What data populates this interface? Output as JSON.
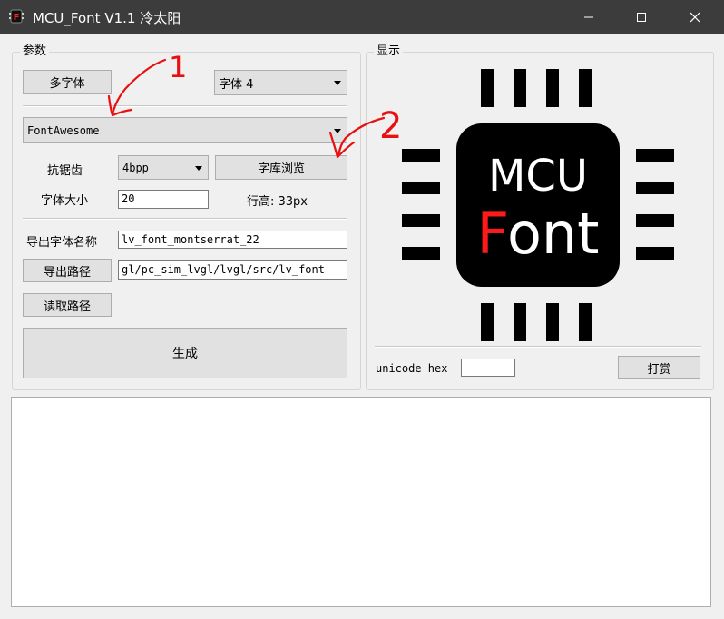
{
  "window": {
    "title": "MCU_Font V1.1  冷太阳",
    "icon_letter": "F"
  },
  "params_group": {
    "title": "参数",
    "multi_font_button": "多字体",
    "font_slot_combo": "字体 4",
    "font_combo": "FontAwesome",
    "antialias_label": "抗锯齿",
    "antialias_combo": "4bpp",
    "browse_button": "字库浏览",
    "font_size_label": "字体大小",
    "font_size_value": "20",
    "line_height_label": "行高: 33px",
    "export_name_label": "导出字体名称",
    "export_name_value": "lv_font_montserrat_22",
    "export_path_button": "导出路径",
    "export_path_value": "gl/pc_sim_lvgl/lvgl/src/lv_font",
    "read_path_button": "读取路径",
    "generate_button": "生成"
  },
  "display_group": {
    "title": "显示",
    "chip_line1": "MCU",
    "chip_line2_first": "F",
    "chip_line2_rest": "ont",
    "unicode_label": "unicode hex",
    "unicode_value": "",
    "reward_button": "打赏"
  },
  "annotations": {
    "mark1": "1",
    "mark2": "2"
  },
  "colors": {
    "titlebar": "#3c3c3c",
    "chip_body": "#000000",
    "chip_accent": "#ff1a1a",
    "annotation": "#e81010"
  },
  "icons": {
    "minimize": "minimize-icon",
    "maximize": "maximize-icon",
    "close": "close-icon"
  }
}
